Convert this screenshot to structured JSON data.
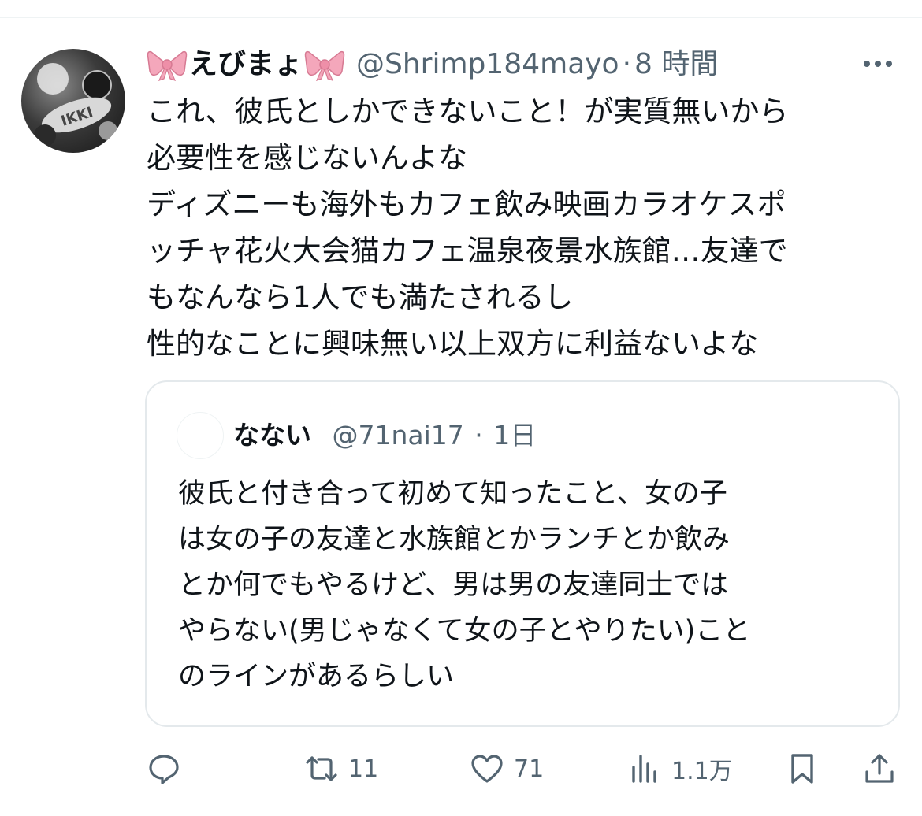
{
  "tweet": {
    "display_name": "えびまょ",
    "handle": "@Shrimp184mayo",
    "separator": "·",
    "time": "8 時間",
    "more_icon": "more-horizontal-icon",
    "avatar_text": "IKKI",
    "body": "これ、彼氏としかできないこと！が実質無いから\n必要性を感じないんよな\nディズニーも海外もカフェ飲み映画カラオケスポ\nッチャ花火大会猫カフェ温泉夜景水族館…友達で\nもなんなら1人でも満たされるし\n性的なことに興味無い以上双方に利益ないよな"
  },
  "quote": {
    "display_name": "なない",
    "handle": "@71nai17",
    "separator": "·",
    "time": "1日",
    "body": "彼氏と付き合って初めて知ったこと、女の子\nは女の子の友達と水族館とかランチとか飲み\nとか何でもやるけど、男は男の友達同士では\nやらない(男じゃなくて女の子とやりたい)こと\nのラインがあるらしい"
  },
  "actions": {
    "reply_icon": "reply-icon",
    "retweet_icon": "retweet-icon",
    "retweet_count": "11",
    "like_icon": "heart-icon",
    "like_count": "71",
    "views_icon": "views-chart-icon",
    "views_count": "1.1万",
    "bookmark_icon": "bookmark-icon",
    "share_icon": "share-icon"
  },
  "colors": {
    "text": "#0f1419",
    "secondary": "#536471",
    "border": "#e4e9ec",
    "bow_pink": "#f4a7bb"
  }
}
